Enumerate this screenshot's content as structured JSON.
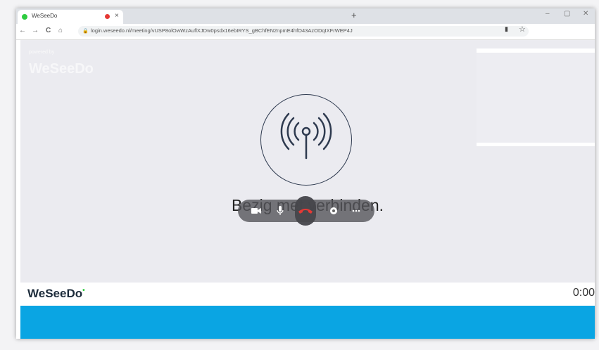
{
  "browser": {
    "tab_title": "WeSeeDo",
    "tab_close": "×",
    "new_tab": "+",
    "window_controls": [
      "–",
      "▢",
      "✕"
    ],
    "nav_back": "←",
    "nav_forward": "→",
    "reload": "C",
    "home": "⌂",
    "url": "login.weseedo.nl/meeting/vUSP8olOwWzAuflXJDw0psdx16ebIRYS_gBChfEN2npmE4hfO43AzODqIXFrWEP4J",
    "lock_icon": "lock-icon",
    "star_icon": "star-icon",
    "camera_icon": "camera-icon"
  },
  "meeting": {
    "powered_by": "powered by",
    "ghost_logo": "WeSeeDo",
    "status_text": "Bezig met verbinden.",
    "signal_icon": "antenna-signal-icon",
    "controls": [
      "camera-icon",
      "microphone-icon",
      "hang-up-icon",
      "chat-icon",
      "more-icon"
    ]
  },
  "footer": {
    "brand": "WeSeeDo",
    "timer": "0:00"
  },
  "colors": {
    "accent_blue": "#0aa5e3",
    "hangup_red": "#e53935",
    "brand_green": "#2ecc40",
    "stage_bg": "#ebebf0"
  }
}
